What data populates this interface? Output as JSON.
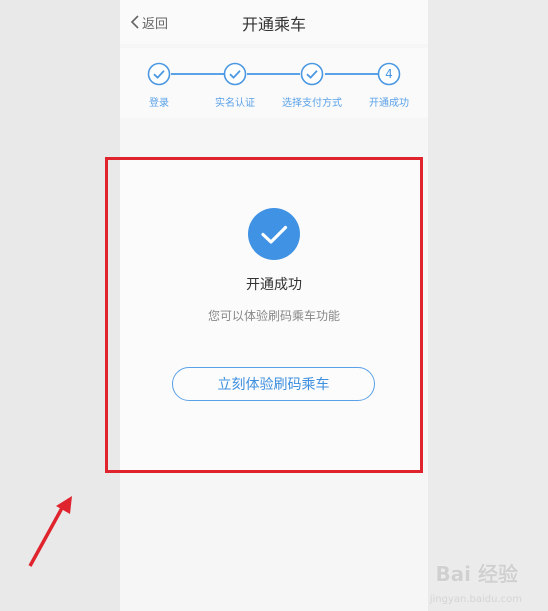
{
  "header": {
    "back_label": "返回",
    "title": "开通乘车"
  },
  "steps": [
    {
      "label": "登录",
      "state": "done"
    },
    {
      "label": "实名认证",
      "state": "done"
    },
    {
      "label": "选择支付方式",
      "state": "done"
    },
    {
      "label": "开通成功",
      "state": "current",
      "number": "4"
    }
  ],
  "result": {
    "title": "开通成功",
    "description": "您可以体验刷码乘车功能",
    "action_label": "立刻体验刷码乘车"
  },
  "watermark": {
    "text": "Bai 经验",
    "sub": "jingyan.baidu.com"
  },
  "colors": {
    "accent": "#4a98e2",
    "highlight": "#e0242e"
  }
}
